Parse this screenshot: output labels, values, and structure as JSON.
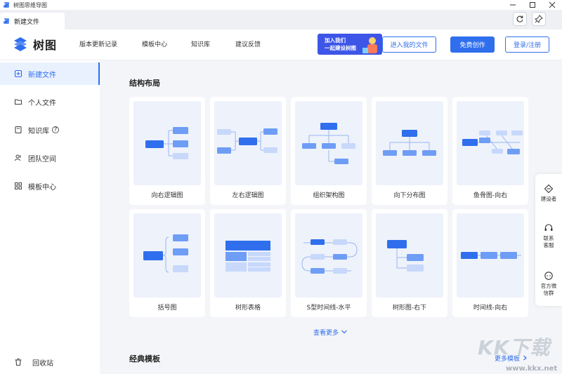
{
  "window": {
    "title": "树图思维导图",
    "controls": [
      "minimize",
      "maximize",
      "close"
    ]
  },
  "tabs": [
    {
      "label": "新建文件",
      "active": true
    }
  ],
  "header": {
    "logo_text": "树图",
    "nav": [
      "版本更新记录",
      "模板中心",
      "知识库",
      "建议反馈"
    ],
    "banner_line1": "加入我们",
    "banner_line2": "一起建设树图",
    "enter_files": "进入我的文件",
    "free_create": "免费创作",
    "login": "登录/注册"
  },
  "sidebar": {
    "items": [
      {
        "label": "新建文件",
        "icon": "new-file-icon",
        "active": true
      },
      {
        "label": "个人文件",
        "icon": "folder-icon",
        "active": false
      },
      {
        "label": "知识库",
        "icon": "book-icon",
        "active": false
      },
      {
        "label": "团队空间",
        "icon": "team-icon",
        "active": false
      },
      {
        "label": "模板中心",
        "icon": "grid-icon",
        "active": false
      }
    ],
    "trash": "回收站"
  },
  "main": {
    "section_structure": "结构布局",
    "cards": [
      "向右逻辑图",
      "左右逻辑图",
      "组织架构图",
      "向下分布图",
      "鱼骨图-向右",
      "括号图",
      "树形表格",
      "S型时间线-水平",
      "树形图-右下",
      "时间线-向右"
    ],
    "see_more": "查看更多",
    "section_classic": "经典模板",
    "more_templates": "更多模板"
  },
  "float_panel": {
    "items": [
      {
        "label": "建设者",
        "icon": "builder-icon"
      },
      {
        "label": "联系客服",
        "icon": "headset-icon"
      },
      {
        "label": "官方微信群",
        "icon": "wechat-icon"
      }
    ]
  },
  "watermark": {
    "big": "KK下载",
    "small": "www.kkx.net"
  },
  "colors": {
    "accent": "#2f6fed",
    "node_dark": "#2f6fed",
    "node_mid": "#6e9df5",
    "node_light": "#c7d8fb",
    "bg": "#f4f5f8"
  }
}
